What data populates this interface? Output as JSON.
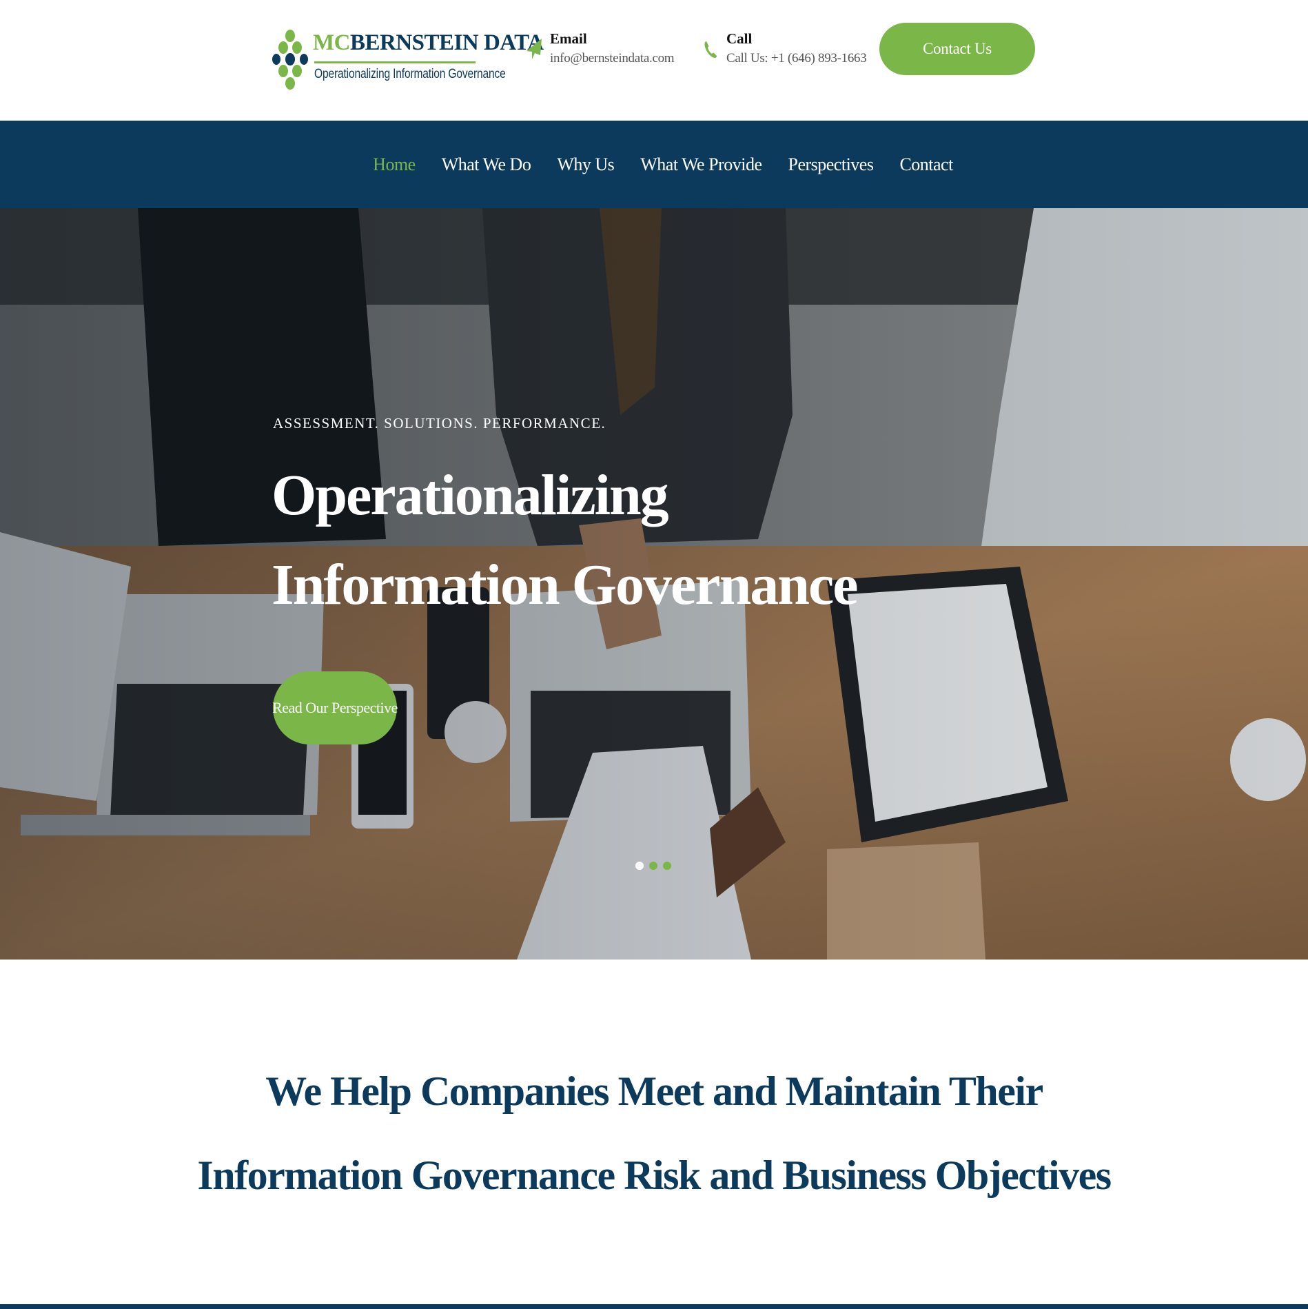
{
  "header": {
    "logo": {
      "brand_prefix": "MC",
      "brand_rest": "BERNSTEIN DATA",
      "tagline": "Operationalizing Information Governance"
    },
    "email": {
      "label": "Email",
      "value": "info@bernsteindata.com",
      "icon": "paper-plane-icon"
    },
    "call": {
      "label": "Call",
      "value": "Call Us: +1 (646) 893-1663",
      "icon": "phone-icon"
    },
    "contact_button": "Contact Us"
  },
  "nav": {
    "items": [
      {
        "label": "Home",
        "active": true
      },
      {
        "label": "What We Do",
        "active": false
      },
      {
        "label": "Why Us",
        "active": false
      },
      {
        "label": "What We Provide",
        "active": false
      },
      {
        "label": "Perspectives",
        "active": false
      },
      {
        "label": "Contact",
        "active": false
      }
    ]
  },
  "hero": {
    "kicker": "ASSESSMENT. SOLUTIONS. PERFORMANCE.",
    "title_line1": "Operationalizing",
    "title_line2": "Information Governance",
    "button": "Read Our Perspective",
    "slides": 3,
    "active_slide": 1
  },
  "intro": {
    "line1": "We Help Companies Meet and Maintain Their",
    "line2": "Information Governance Risk and Business Objectives"
  },
  "colors": {
    "brand_navy": "#0b3a5c",
    "brand_green": "#7ab648"
  }
}
